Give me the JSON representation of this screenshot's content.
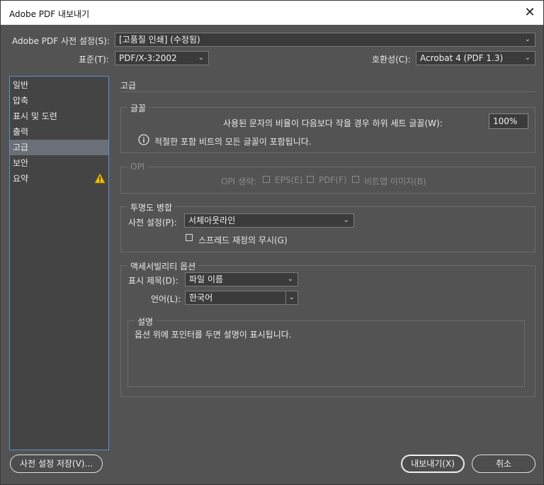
{
  "window": {
    "title": "Adobe PDF 내보내기",
    "close_glyph": "✕"
  },
  "top": {
    "preset_label": "Adobe PDF 사전 설정(S):",
    "preset_value": "[고품질 인쇄] (수정됨)",
    "standard_label": "표준(T):",
    "standard_value": "PDF/X-3:2002",
    "compat_label": "호환성(C):",
    "compat_value": "Acrobat 4 (PDF 1.3)"
  },
  "sidebar": {
    "items": [
      {
        "label": "일반"
      },
      {
        "label": "압축"
      },
      {
        "label": "표시 및 도련"
      },
      {
        "label": "출력"
      },
      {
        "label": "고급"
      },
      {
        "label": "보안"
      },
      {
        "label": "요약"
      }
    ],
    "selected": "고급",
    "warning_icon": "warning-triangle-icon"
  },
  "panel": {
    "title": "고급",
    "fonts": {
      "title": "글꼴",
      "subset_label": "사용된 문자의 비율이 다음보다 작을 경우 하위 세트 글꼴(W):",
      "subset_value": "100%",
      "info_text": "적절한 포함 비트의 모든 글꼴이 포함됩니다."
    },
    "opi": {
      "title": "OPI",
      "omit_label": "OPI 생략:",
      "eps": "EPS(E)",
      "pdf": "PDF(F)",
      "bitmap": "비트맵 이미지(B)"
    },
    "transparency": {
      "title": "투명도 병합",
      "preset_label": "사전 설정(P):",
      "preset_value": "서체아웃라인",
      "ignore_spread": "스프레드 재정의 무시(G)"
    },
    "accessibility": {
      "title": "액세서빌리티 옵션",
      "display_title_label": "표시 제목(D):",
      "display_title_value": "파일 이름",
      "language_label": "언어(L):",
      "language_value": "한국어"
    },
    "description": {
      "title": "설명",
      "text": "옵션 위에 포인터를 두면 설명이 표시됩니다."
    }
  },
  "buttons": {
    "save_preset": "사전 설정 저장(V)...",
    "export": "내보내기(X)",
    "cancel": "취소"
  }
}
